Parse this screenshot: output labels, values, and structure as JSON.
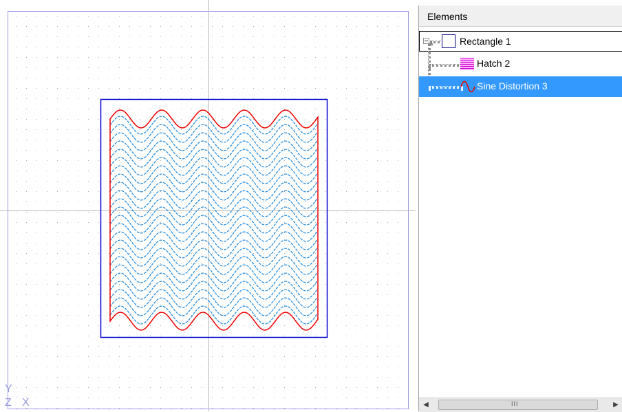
{
  "elements_panel": {
    "title": "Elements",
    "items": [
      {
        "label": "Rectangle 1",
        "icon": "rectangle-icon",
        "expanded": true
      },
      {
        "label": "Hatch 2",
        "icon": "hatch-icon"
      },
      {
        "label": "Sine Distortion 3",
        "icon": "sine-wave-icon",
        "selected": true
      }
    ],
    "scrollbar": {
      "grip": "III",
      "left_arrow": "◀",
      "right_arrow": "▶"
    }
  },
  "canvas": {
    "axis_labels": {
      "y": "Y",
      "z": "Z",
      "x": "X"
    },
    "colors": {
      "grid": "#aaaaaa",
      "axis": "#b8b8b8",
      "border": "#9b9bdf",
      "rectangle": "#0000d0",
      "outline": "#ee0000",
      "hatch": "#2a8fe0",
      "selection": "#3399ff"
    }
  }
}
